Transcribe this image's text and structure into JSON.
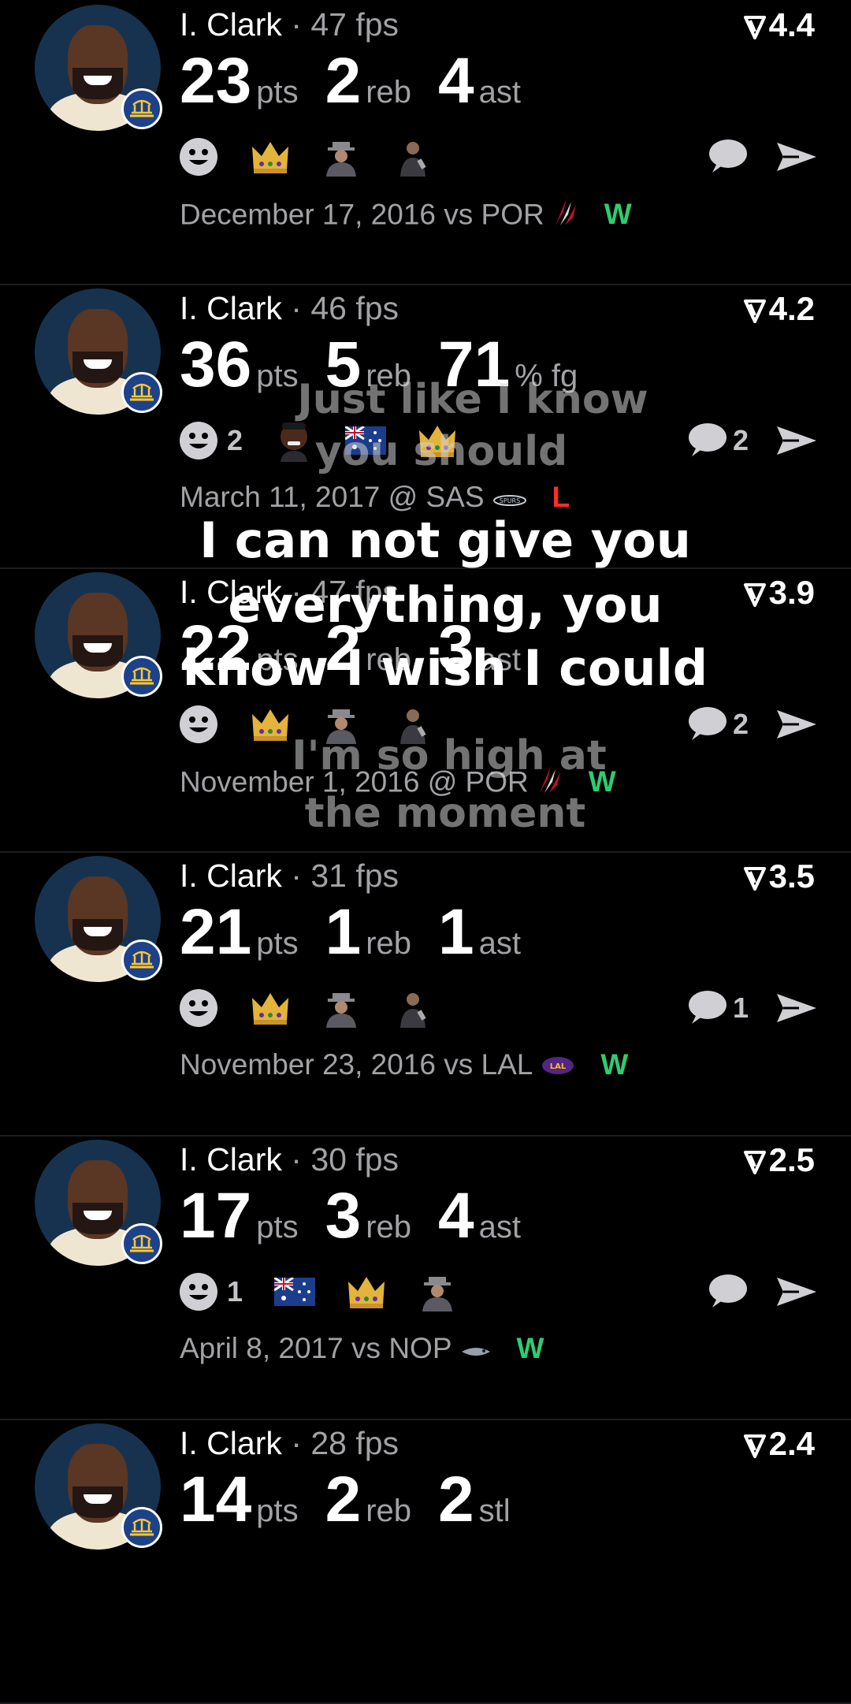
{
  "cards": [
    {
      "name": "I. Clark",
      "sep": "·",
      "fps": "47 fps",
      "rating": "4.4",
      "stats": [
        {
          "value": "23",
          "unit": "pts"
        },
        {
          "value": "2",
          "unit": "reb"
        },
        {
          "value": "4",
          "unit": "ast"
        }
      ],
      "reactions": [
        {
          "icon": "smiley-face-icon",
          "count": ""
        },
        {
          "icon": "crown-icon",
          "count": ""
        },
        {
          "icon": "hat-man-icon",
          "count": ""
        },
        {
          "icon": "coach-icon",
          "count": ""
        }
      ],
      "comment_count": "",
      "date": "December 17, 2016",
      "vs": "vs",
      "opponent": "POR",
      "opponent_logo": "blazers-logo-icon",
      "result": "W"
    },
    {
      "name": "I. Clark",
      "sep": "·",
      "fps": "46 fps",
      "rating": "4.2",
      "stats": [
        {
          "value": "36",
          "unit": "pts"
        },
        {
          "value": "5",
          "unit": "reb"
        },
        {
          "value": "71",
          "unit": "% fg"
        }
      ],
      "reactions": [
        {
          "icon": "smiley-face-icon",
          "count": "2"
        },
        {
          "icon": "player-face-icon",
          "count": ""
        },
        {
          "icon": "australia-flag-icon",
          "count": ""
        },
        {
          "icon": "crown-icon",
          "count": ""
        }
      ],
      "comment_count": "2",
      "date": "March 11, 2017",
      "vs": "@",
      "opponent": "SAS",
      "opponent_logo": "spurs-logo-icon",
      "result": "L"
    },
    {
      "name": "I. Clark",
      "sep": "·",
      "fps": "47 fps",
      "rating": "3.9",
      "stats": [
        {
          "value": "22",
          "unit": "pts"
        },
        {
          "value": "2",
          "unit": "reb"
        },
        {
          "value": "3",
          "unit": "ast"
        }
      ],
      "reactions": [
        {
          "icon": "smiley-face-icon",
          "count": ""
        },
        {
          "icon": "crown-icon",
          "count": ""
        },
        {
          "icon": "hat-man-icon",
          "count": ""
        },
        {
          "icon": "coach-icon",
          "count": ""
        }
      ],
      "comment_count": "2",
      "date": "November 1, 2016",
      "vs": "@",
      "opponent": "POR",
      "opponent_logo": "blazers-logo-icon",
      "result": "W"
    },
    {
      "name": "I. Clark",
      "sep": "·",
      "fps": "31 fps",
      "rating": "3.5",
      "stats": [
        {
          "value": "21",
          "unit": "pts"
        },
        {
          "value": "1",
          "unit": "reb"
        },
        {
          "value": "1",
          "unit": "ast"
        }
      ],
      "reactions": [
        {
          "icon": "smiley-face-icon",
          "count": ""
        },
        {
          "icon": "crown-icon",
          "count": ""
        },
        {
          "icon": "hat-man-icon",
          "count": ""
        },
        {
          "icon": "coach-icon",
          "count": ""
        }
      ],
      "comment_count": "1",
      "date": "November 23, 2016",
      "vs": "vs",
      "opponent": "LAL",
      "opponent_logo": "lakers-logo-icon",
      "result": "W"
    },
    {
      "name": "I. Clark",
      "sep": "·",
      "fps": "30 fps",
      "rating": "2.5",
      "stats": [
        {
          "value": "17",
          "unit": "pts"
        },
        {
          "value": "3",
          "unit": "reb"
        },
        {
          "value": "4",
          "unit": "ast"
        }
      ],
      "reactions": [
        {
          "icon": "smiley-face-icon",
          "count": "1"
        },
        {
          "icon": "australia-flag-icon",
          "count": ""
        },
        {
          "icon": "crown-icon",
          "count": ""
        },
        {
          "icon": "hat-man-icon",
          "count": ""
        }
      ],
      "comment_count": "",
      "date": "April 8, 2017",
      "vs": "vs",
      "opponent": "NOP",
      "opponent_logo": "pelicans-logo-icon",
      "result": "W"
    },
    {
      "name": "I. Clark",
      "sep": "·",
      "fps": "28 fps",
      "rating": "2.4",
      "stats": [
        {
          "value": "14",
          "unit": "pts"
        },
        {
          "value": "2",
          "unit": "reb"
        },
        {
          "value": "2",
          "unit": "stl"
        }
      ],
      "reactions": [],
      "comment_count": "",
      "date": "",
      "vs": "",
      "opponent": "",
      "opponent_logo": "",
      "result": ""
    }
  ],
  "lyrics": [
    {
      "text": "Just like I know",
      "style": "faded"
    },
    {
      "text": "you should",
      "style": "faded"
    },
    {
      "text": "I can not give you",
      "style": "main"
    },
    {
      "text": "everything, you",
      "style": "main"
    },
    {
      "text": "know I wish I could",
      "style": "main"
    },
    {
      "text": "I'm so high at",
      "style": "faded"
    },
    {
      "text": "the moment",
      "style": "faded"
    }
  ],
  "colors": {
    "background": "#000000",
    "win": "#2ecc71",
    "loss": "#ff2d2d",
    "muted": "#a2a2a6",
    "team_badge": "#1d428a"
  }
}
